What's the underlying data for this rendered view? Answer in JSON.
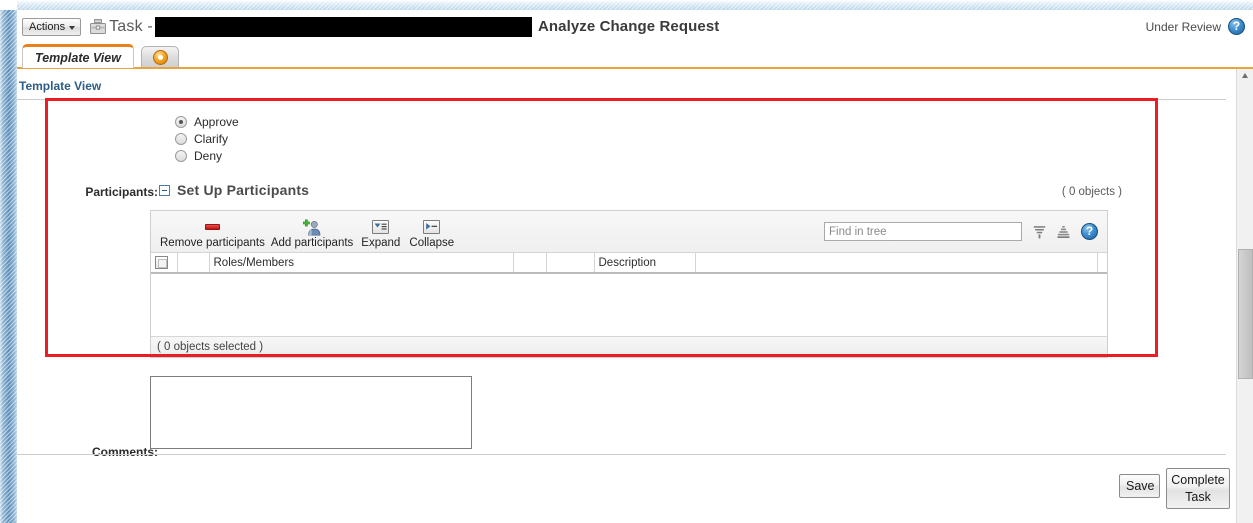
{
  "header": {
    "actions_label": "Actions",
    "task_word": "Task -",
    "task_icon": "briefcase-icon",
    "redacted": "",
    "task_title": "Analyze Change Request",
    "status": "Under Review",
    "help_icon": "help-circle-icon"
  },
  "tabs": [
    {
      "label": "Template View",
      "active": true
    },
    {
      "label": "",
      "icon": "orange-gear-icon",
      "active": false
    }
  ],
  "section": {
    "title": "Template View"
  },
  "decision": {
    "options": [
      {
        "label": "Approve",
        "checked": true
      },
      {
        "label": "Clarify",
        "checked": false
      },
      {
        "label": "Deny",
        "checked": false
      }
    ]
  },
  "participants": {
    "field_label": "Participants:",
    "panel_title": "Set Up Participants",
    "object_count": "( 0 objects )",
    "toolbar": [
      {
        "label": "Remove participants",
        "icon": "minus-icon"
      },
      {
        "label": "Add participants",
        "icon": "add-user-icon"
      },
      {
        "label": "Expand",
        "icon": "expand-icon"
      },
      {
        "label": "Collapse",
        "icon": "collapse-icon"
      }
    ],
    "find": {
      "value": "",
      "placeholder": "Find in tree"
    },
    "filter_icon": "funnel-icon",
    "sort_icon": "pyramid-icon",
    "help_icon": "help-circle-icon",
    "columns": [
      {
        "label": "",
        "type": "checkbox"
      },
      {
        "label": ""
      },
      {
        "label": "Roles/Members"
      },
      {
        "label": ""
      },
      {
        "label": ""
      },
      {
        "label": "Description"
      },
      {
        "label": ""
      },
      {
        "label": ""
      }
    ],
    "rows": [],
    "status": "( 0 objects selected )"
  },
  "comments": {
    "label": "Comments:",
    "value": "",
    "placeholder": ""
  },
  "footer": {
    "save_label": "Save",
    "complete_label": "Complete Task"
  },
  "colors": {
    "accent_orange": "#e8811a",
    "annotation_red": "#ee1b24",
    "link_blue": "#2c5d86"
  }
}
